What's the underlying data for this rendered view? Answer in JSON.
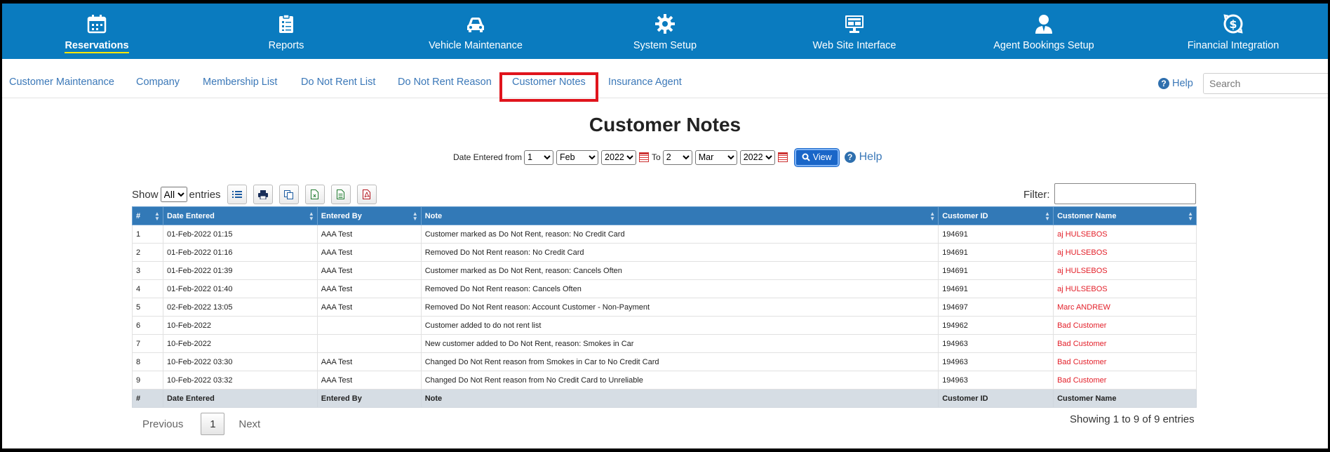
{
  "topnav": [
    {
      "label": "Reservations",
      "icon": "calendar-icon",
      "active": true
    },
    {
      "label": "Reports",
      "icon": "clipboard-icon"
    },
    {
      "label": "Vehicle Maintenance",
      "icon": "car-icon"
    },
    {
      "label": "System Setup",
      "icon": "gear-icon"
    },
    {
      "label": "Web Site Interface",
      "icon": "monitor-icon"
    },
    {
      "label": "Agent Bookings Setup",
      "icon": "agent-icon"
    },
    {
      "label": "Financial Integration",
      "icon": "dollar-icon"
    }
  ],
  "subnav": [
    "Customer Maintenance",
    "Company",
    "Membership List",
    "Do Not Rent List",
    "Do Not Rent Reason",
    "Customer Notes",
    "Insurance Agent"
  ],
  "help_label": "Help",
  "search_placeholder": "Search",
  "page_title": "Customer Notes",
  "date_filter": {
    "from_label": "Date Entered from",
    "to_label": "To",
    "from": {
      "day": "1",
      "month": "Feb",
      "year": "2022"
    },
    "to": {
      "day": "2",
      "month": "Mar",
      "year": "2022"
    },
    "view_label": "View",
    "help_label": "Help"
  },
  "show": {
    "prefix": "Show",
    "value": "All",
    "suffix": "entries"
  },
  "filter_label": "Filter:",
  "columns": [
    "#",
    "Date Entered",
    "Entered By",
    "Note",
    "Customer ID",
    "Customer Name"
  ],
  "rows": [
    [
      "1",
      "01-Feb-2022 01:15",
      "AAA Test",
      "Customer marked as Do Not Rent, reason: No Credit Card",
      "194691",
      "aj HULSEBOS"
    ],
    [
      "2",
      "01-Feb-2022 01:16",
      "AAA Test",
      "Removed Do Not Rent reason: No Credit Card",
      "194691",
      "aj HULSEBOS"
    ],
    [
      "3",
      "01-Feb-2022 01:39",
      "AAA Test",
      "Customer marked as Do Not Rent, reason: Cancels Often",
      "194691",
      "aj HULSEBOS"
    ],
    [
      "4",
      "01-Feb-2022 01:40",
      "AAA Test",
      "Removed Do Not Rent reason: Cancels Often",
      "194691",
      "aj HULSEBOS"
    ],
    [
      "5",
      "02-Feb-2022 13:05",
      "AAA Test",
      "Removed Do Not Rent reason: Account Customer - Non-Payment",
      "194697",
      "Marc ANDREW"
    ],
    [
      "6",
      "10-Feb-2022",
      "",
      "Customer added to do not rent list",
      "194962",
      "Bad Customer"
    ],
    [
      "7",
      "10-Feb-2022",
      "",
      "New customer added to Do Not Rent, reason: Smokes in Car",
      "194963",
      "Bad Customer"
    ],
    [
      "8",
      "10-Feb-2022 03:30",
      "AAA Test",
      "Changed Do Not Rent reason from Smokes in Car to No Credit Card",
      "194963",
      "Bad Customer"
    ],
    [
      "9",
      "10-Feb-2022 03:32",
      "AAA Test",
      "Changed Do Not Rent reason from No Credit Card to Unreliable",
      "194963",
      "Bad Customer"
    ]
  ],
  "pagination": {
    "previous": "Previous",
    "page": "1",
    "next": "Next"
  },
  "info": "Showing 1 to 9 of 9 entries",
  "colors": {
    "nav_bg": "#0a7bbf",
    "header_bg": "#3279b7",
    "link": "#3b78b8",
    "customer_name": "#e3202a",
    "highlight": "#e0141c"
  }
}
